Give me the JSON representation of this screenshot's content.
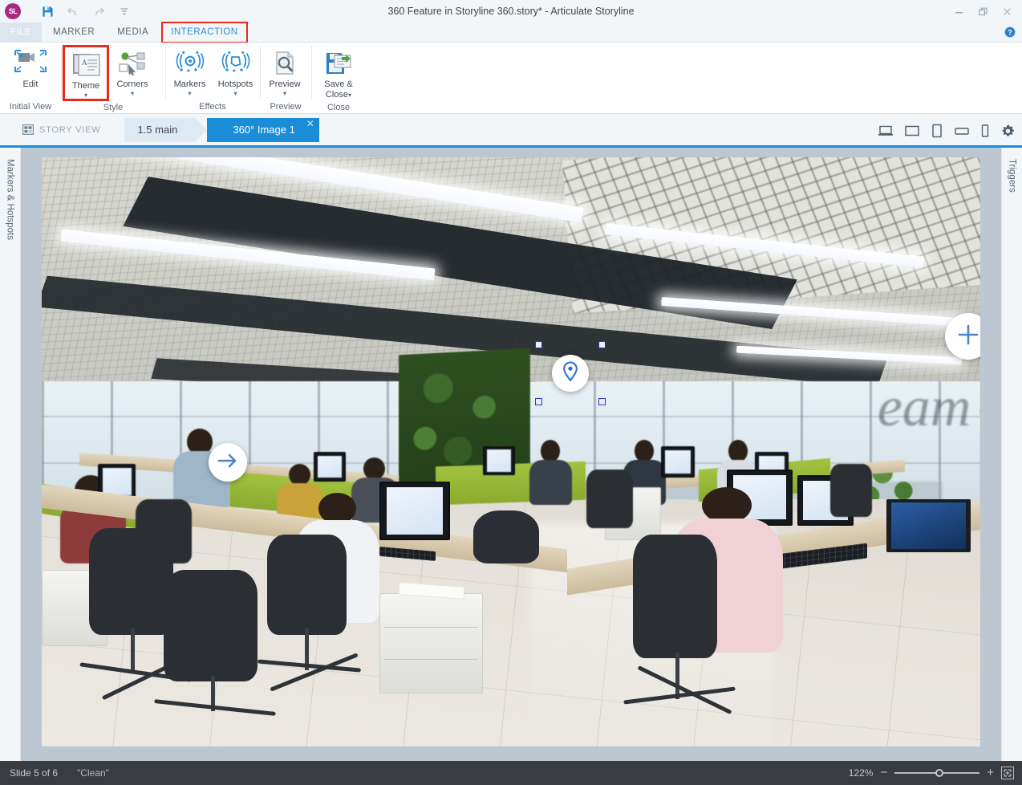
{
  "window": {
    "title": "360 Feature in Storyline 360.story*  -  Articulate Storyline",
    "logo_text": "SL",
    "minimize_label": "–",
    "restore_label": "❐",
    "close_label": "✕"
  },
  "quick_access": [
    {
      "name": "save-icon",
      "label": "Save"
    },
    {
      "name": "undo-icon",
      "label": "Undo"
    },
    {
      "name": "redo-icon",
      "label": "Redo"
    },
    {
      "name": "customize-qat-icon",
      "label": "Customize Quick Access Toolbar"
    }
  ],
  "ribbon_tabs": [
    {
      "label": "FILE",
      "active": false,
      "highlight": false
    },
    {
      "label": "MARKER",
      "active": false,
      "highlight": false
    },
    {
      "label": "MEDIA",
      "active": false,
      "highlight": false
    },
    {
      "label": "INTERACTION",
      "active": true,
      "highlight": true
    }
  ],
  "help": {
    "label": "?"
  },
  "ribbon_groups": [
    {
      "label": "Initial View",
      "buttons": [
        {
          "label": "Edit",
          "icon": "camera-view-icon",
          "caret": false,
          "selected": false
        }
      ]
    },
    {
      "label": "Style",
      "buttons": [
        {
          "label": "Theme",
          "icon": "theme-icon",
          "caret": true,
          "selected": true
        },
        {
          "label": "Corners",
          "icon": "corners-icon",
          "caret": true,
          "selected": false
        }
      ]
    },
    {
      "label": "Effects",
      "buttons": [
        {
          "label": "Markers",
          "icon": "markers-icon",
          "caret": true,
          "selected": false
        },
        {
          "label": "Hotspots",
          "icon": "hotspots-icon",
          "caret": true,
          "selected": false
        }
      ]
    },
    {
      "label": "Preview",
      "buttons": [
        {
          "label": "Preview",
          "icon": "preview-magnifier-icon",
          "caret": true,
          "selected": false
        }
      ]
    },
    {
      "label": "Close",
      "buttons": [
        {
          "label": "Save &\nClose",
          "label_line1": "Save &",
          "label_line2": "Close",
          "icon": "save-and-close-icon",
          "caret": true,
          "selected": false
        }
      ]
    }
  ],
  "slide_bar": {
    "story_view_label": "STORY VIEW",
    "story_view_icon": "story-view-icon",
    "breadcrumbs": [
      {
        "label": "1.5 main",
        "active": false
      },
      {
        "label": "360° Image 1",
        "active": true,
        "closeable": true,
        "close_label": "✕"
      }
    ],
    "device_buttons": [
      {
        "name": "preview-laptop-icon",
        "label": "Laptop"
      },
      {
        "name": "preview-tablet-landscape-icon",
        "label": "Tablet Landscape"
      },
      {
        "name": "preview-tablet-portrait-icon",
        "label": "Tablet Portrait"
      },
      {
        "name": "preview-phone-landscape-icon",
        "label": "Phone Landscape"
      },
      {
        "name": "preview-phone-portrait-icon",
        "label": "Phone Portrait"
      },
      {
        "name": "player-settings-gear-icon",
        "label": "Player Settings"
      }
    ]
  },
  "panels": {
    "left_rail_label": "Markers & Hotspots",
    "right_rail_label": "Triggers"
  },
  "canvas": {
    "scene_description": "360° panoramic photo of an open-plan office: suspended acoustic ceiling with linear LED light bars, floor-to-ceiling windows, a living green wall, rows of light-wood desks with green privacy panels, black mesh task chairs, monitors, keyboards and laptops, and masked employees working.",
    "overlay_controls": [
      {
        "name": "nav-arrow-button",
        "icon": "arrow-right-icon",
        "label": "Navigate"
      },
      {
        "name": "zoom-in-button",
        "icon": "plus-icon",
        "label": "Zoom In"
      }
    ],
    "marker": {
      "name": "map-pin-marker",
      "icon": "map-pin-icon",
      "selected": true,
      "handle_count": 4
    }
  },
  "status_bar": {
    "slide_label": "Slide 5 of 6",
    "scene_label": "\"Clean\"",
    "zoom_percent": "122%",
    "zoom_out_label": "−",
    "zoom_in_label": "+",
    "fit_label": "Fit to window"
  },
  "colors": {
    "accent_blue": "#1a8cd8",
    "highlight_red": "#e8291c",
    "marker_blue": "#2f6fd0",
    "status_bg": "#3b3b42",
    "canvas_bg": "#bcc7d1"
  }
}
